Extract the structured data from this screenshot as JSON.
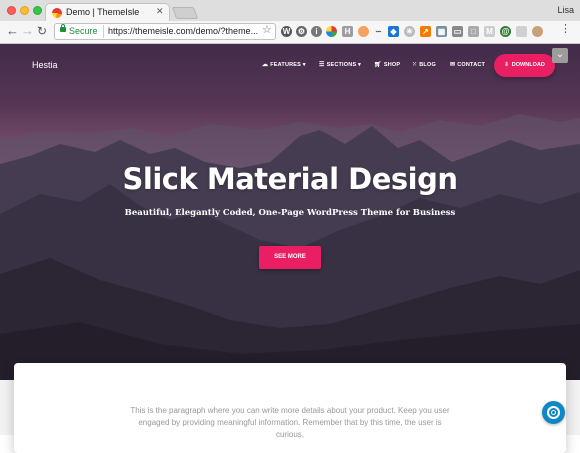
{
  "browser": {
    "tab_title": "Demo | ThemeIsle",
    "profile_name": "Lisa",
    "secure_label": "Secure",
    "url": "https://themeisle.com/demo/?theme...",
    "extensions": [
      "wordpress-icon",
      "gear-icon",
      "info-icon",
      "pinwheel-icon",
      "h-icon",
      "squirrel-icon",
      "curve-icon",
      "dropbox-icon",
      "settings-icon",
      "analytics-icon",
      "grid-icon",
      "cast-icon",
      "window-icon",
      "m-icon",
      "swirl-icon",
      "addon-icon",
      "avatar-icon"
    ]
  },
  "site": {
    "brand": "Hestia",
    "nav": {
      "features": "FEATURES",
      "sections": "SECTIONS",
      "shop": "SHOP",
      "blog": "BLOG",
      "contact": "CONTACT",
      "download": "DOWNLOAD"
    },
    "hero": {
      "title": "Slick Material Design",
      "subtitle": "Beautiful, Elegantly Coded, One-Page WordPress Theme for Business",
      "cta": "SEE MORE"
    },
    "content": {
      "paragraph": "This is the paragraph where you can write more details about your product. Keep you user engaged by providing meaningful information. Remember that by this time, the user is curious,"
    }
  },
  "colors": {
    "accent": "#e91e63",
    "help": "#0f86c6"
  }
}
